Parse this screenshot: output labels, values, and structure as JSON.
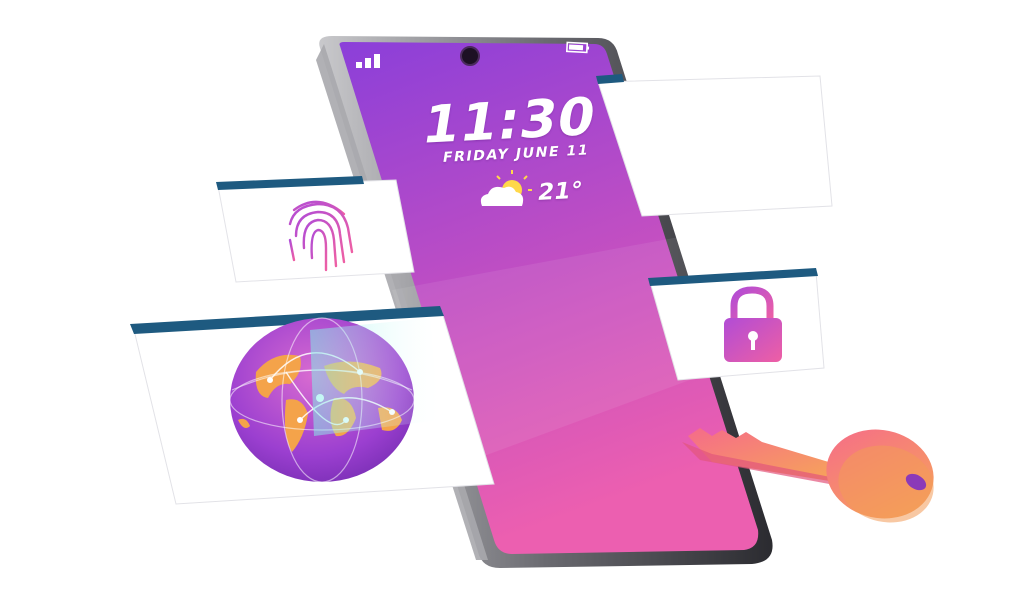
{
  "lockscreen": {
    "time": "11:30",
    "date": "FRIDAY  JUNE 11",
    "temperature": "21°",
    "weather_icon": "partly-cloudy-icon",
    "signal_icon": "signal-bars-icon",
    "battery_icon": "battery-icon"
  },
  "cards": {
    "fingerprint_icon": "fingerprint-icon",
    "globe_icon": "globe-icon",
    "lock_icon": "padlock-icon"
  },
  "key_icon": "key-icon",
  "colors": {
    "screen_top": "#8b3fd9",
    "screen_bottom": "#ec5fb0",
    "card_header": "#1e5a80",
    "card_body": "#ffffff",
    "key_pink": "#f46aa0",
    "key_orange": "#f59a5a"
  }
}
